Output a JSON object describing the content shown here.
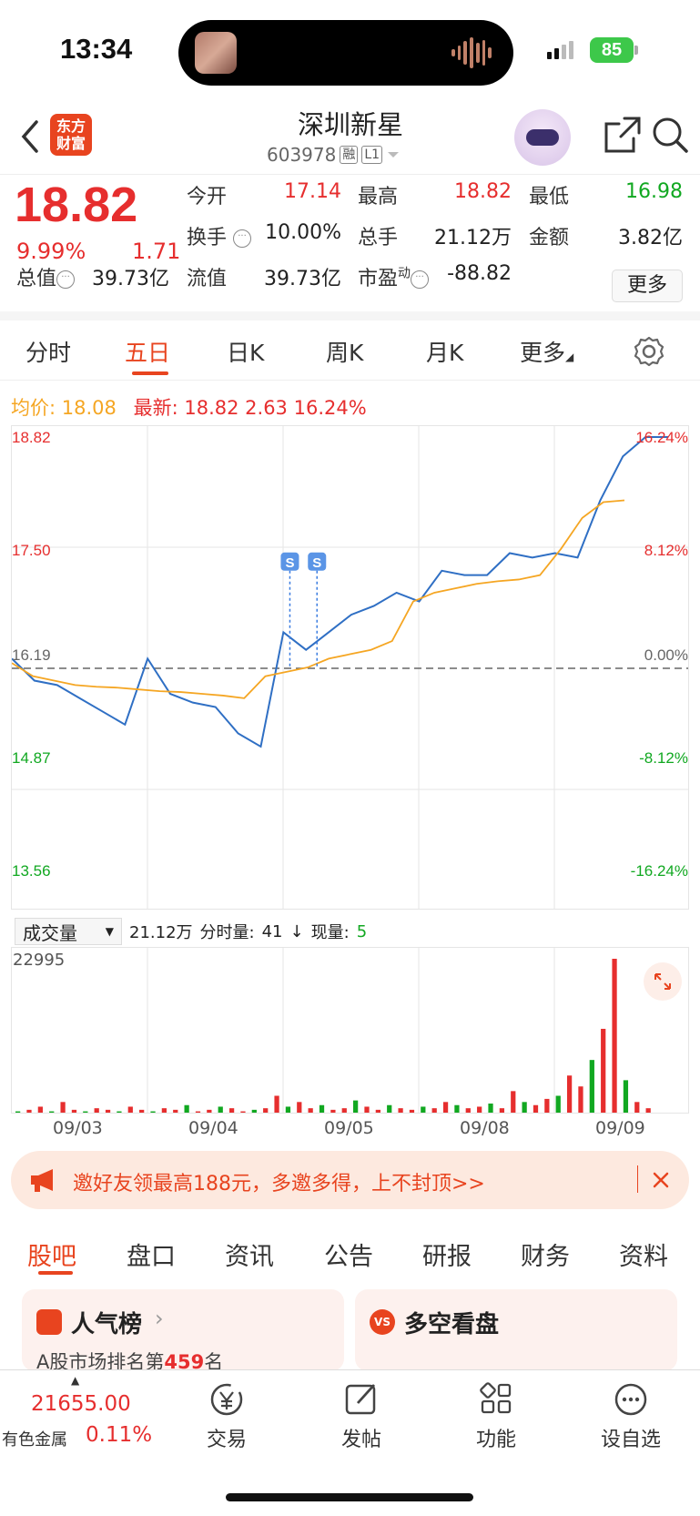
{
  "status": {
    "time": "13:34",
    "battery": "85"
  },
  "header": {
    "logo_line1": "东方",
    "logo_line2": "财富",
    "stock_name": "深圳新星",
    "stock_code": "603978",
    "tag_rong": "融",
    "tag_level": "L1"
  },
  "quote": {
    "price": "18.82",
    "change_pct": "9.99%",
    "change": "1.71",
    "open_label": "今开",
    "open": "17.14",
    "high_label": "最高",
    "high": "18.82",
    "low_label": "最低",
    "low": "16.98",
    "turnover_label": "换手",
    "turnover": "10.00%",
    "volume_label": "总手",
    "volume": "21.12万",
    "amount_label": "金额",
    "amount": "3.82亿",
    "mktcap_label": "总值",
    "mktcap": "39.73亿",
    "float_label": "流值",
    "float": "39.73亿",
    "pe_label": "市盈",
    "pe_sup": "动",
    "pe": "-88.82",
    "more": "更多"
  },
  "tabs": [
    "分时",
    "五日",
    "日K",
    "周K",
    "月K",
    "更多"
  ],
  "legend": {
    "avg_label": "均价:",
    "avg": "18.08",
    "latest_label": "最新:",
    "latest": "18.82",
    "chg": "2.63",
    "chg_pct": "16.24%"
  },
  "chart_data": {
    "type": "line",
    "x_categories": [
      "09/03",
      "09/04",
      "09/05",
      "09/08",
      "09/09"
    ],
    "y_ticks_left": [
      "18.82",
      "17.50",
      "16.19",
      "14.87",
      "13.56"
    ],
    "y_ticks_right": [
      "16.24%",
      "8.12%",
      "0.00%",
      "-8.12%",
      "-16.24%"
    ],
    "ylim": [
      13.56,
      18.82
    ],
    "reference": 16.19,
    "series": [
      {
        "name": "价格",
        "color": "#2f6fc4",
        "values": [
          16.3,
          16.05,
          16.0,
          15.85,
          15.7,
          15.55,
          16.3,
          15.9,
          15.8,
          15.75,
          15.45,
          15.3,
          16.6,
          16.4,
          16.6,
          16.8,
          16.9,
          17.05,
          16.95,
          17.3,
          17.25,
          17.25,
          17.5,
          17.45,
          17.5,
          17.45,
          18.1,
          18.6,
          18.82,
          18.82
        ]
      },
      {
        "name": "均价",
        "color": "#f5a623",
        "values": [
          16.25,
          16.1,
          16.05,
          16.0,
          15.98,
          15.97,
          15.95,
          15.93,
          15.92,
          15.9,
          15.88,
          15.85,
          16.1,
          16.15,
          16.2,
          16.3,
          16.35,
          16.4,
          16.5,
          16.95,
          17.05,
          17.1,
          17.15,
          17.18,
          17.2,
          17.25,
          17.55,
          17.9,
          18.08,
          18.1
        ]
      }
    ],
    "markers": [
      "S",
      "S"
    ]
  },
  "volume": {
    "selector": "成交量",
    "total": "21.12万",
    "tick_label": "分时量:",
    "tick_value": "41",
    "arrow": "↓",
    "now_label": "现量:",
    "now_value": "5",
    "max": "22995"
  },
  "volume_data": {
    "type": "bar",
    "values": [
      0.02,
      0.03,
      0.05,
      0.02,
      0.08,
      0.03,
      0.02,
      0.04,
      0.03,
      0.02,
      0.05,
      0.03,
      0.02,
      0.04,
      0.03,
      0.06,
      0.02,
      0.03,
      0.05,
      0.04,
      0.02,
      0.03,
      0.04,
      0.12,
      0.05,
      0.08,
      0.04,
      0.06,
      0.03,
      0.04,
      0.09,
      0.05,
      0.03,
      0.06,
      0.04,
      0.03,
      0.05,
      0.04,
      0.08,
      0.06,
      0.04,
      0.05,
      0.07,
      0.04,
      0.15,
      0.08,
      0.06,
      0.1,
      0.12,
      0.25,
      0.18,
      0.35,
      0.55,
      1.0,
      0.22,
      0.08,
      0.04
    ]
  },
  "banner": {
    "text": "邀好友领最高188元，多邀多得，上不封顶>>"
  },
  "bottom_tabs": [
    "股吧",
    "盘口",
    "资讯",
    "公告",
    "研报",
    "财务",
    "资料"
  ],
  "cards": {
    "hot_title": "人气榜",
    "hot_sub_prefix": "A股市场排名第",
    "hot_rank": "459",
    "hot_sub_suffix": "名",
    "bull_title": "多空看盘"
  },
  "footer": {
    "index_value": "21655.00",
    "index_name": "有色金属",
    "index_pct": "0.11%",
    "items": [
      "交易",
      "发帖",
      "功能",
      "设自选"
    ]
  }
}
